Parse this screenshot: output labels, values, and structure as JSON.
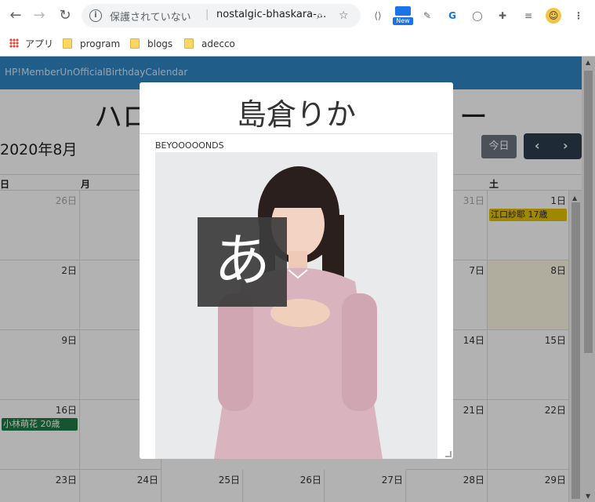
{
  "browser": {
    "security_text": "保護されていない",
    "url": "nostalgic-bhaskara-...",
    "new_badge": "New",
    "bookmarks": [
      {
        "label": "アプリ",
        "icon": "apps-grid-icon"
      },
      {
        "label": "program",
        "icon": "folder-icon"
      },
      {
        "label": "blogs",
        "icon": "folder-icon"
      },
      {
        "label": "adecco",
        "icon": "folder-icon"
      }
    ]
  },
  "app": {
    "brand": "HP!MemberUnOfficialBirthdayCalendar",
    "title_left": "ハロ",
    "title_right": "ー",
    "month_label": "2020年8月",
    "today_label": "今日",
    "prev_icon": "‹",
    "next_icon": "›",
    "dow": [
      "日",
      "月",
      "土"
    ]
  },
  "calendar": {
    "week1": {
      "sun": "26日",
      "wed_hidden": "31日",
      "sat": "1日"
    },
    "week2": {
      "sun": "2日",
      "fri": "7日",
      "sat": "8日"
    },
    "week3": {
      "sun": "9日",
      "fri": "14日",
      "sat": "15日"
    },
    "week4": {
      "sun": "16日",
      "fri": "21日",
      "sat": "22日"
    },
    "week5": {
      "sun": "23日",
      "mon": "24日",
      "tue": "25日",
      "wed": "26日",
      "thu": "27日",
      "fri": "28日",
      "sat": "29日"
    },
    "events": [
      {
        "label": "江口紗耶 17歳",
        "color": "#e6c200"
      },
      {
        "label": "小林萌花 20歳",
        "color": "#1f7a45"
      }
    ]
  },
  "modal": {
    "name": "島倉りか",
    "group": "BEYOOOOONDS",
    "initial": "あ"
  }
}
